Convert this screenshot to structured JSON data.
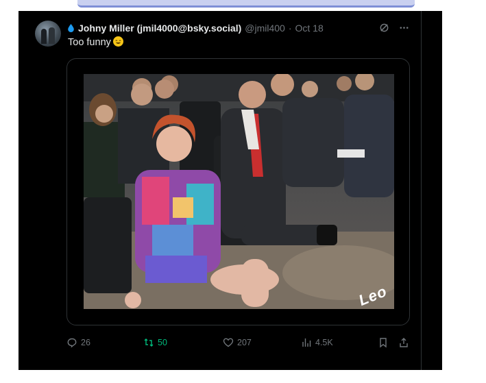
{
  "post": {
    "author_name": "Johny Miller (jmil4000@bsky.social)",
    "handle": "@jmil400",
    "separator": "·",
    "date": "Oct 18",
    "text": "Too funny",
    "watermark": "Leo",
    "colors": {
      "background": "#000000",
      "text": "#e7e9ea",
      "muted": "#71767b",
      "repost_active": "#00ba7c"
    }
  },
  "actions": {
    "reply_count": "26",
    "repost_count": "50",
    "like_count": "207",
    "views_count": "4.5K"
  },
  "icons": [
    "water-drop-icon",
    "grok-icon",
    "more-icon",
    "reply-icon",
    "repost-icon",
    "like-icon",
    "views-icon",
    "bookmark-icon",
    "share-icon",
    "laughing-emoji-icon"
  ]
}
